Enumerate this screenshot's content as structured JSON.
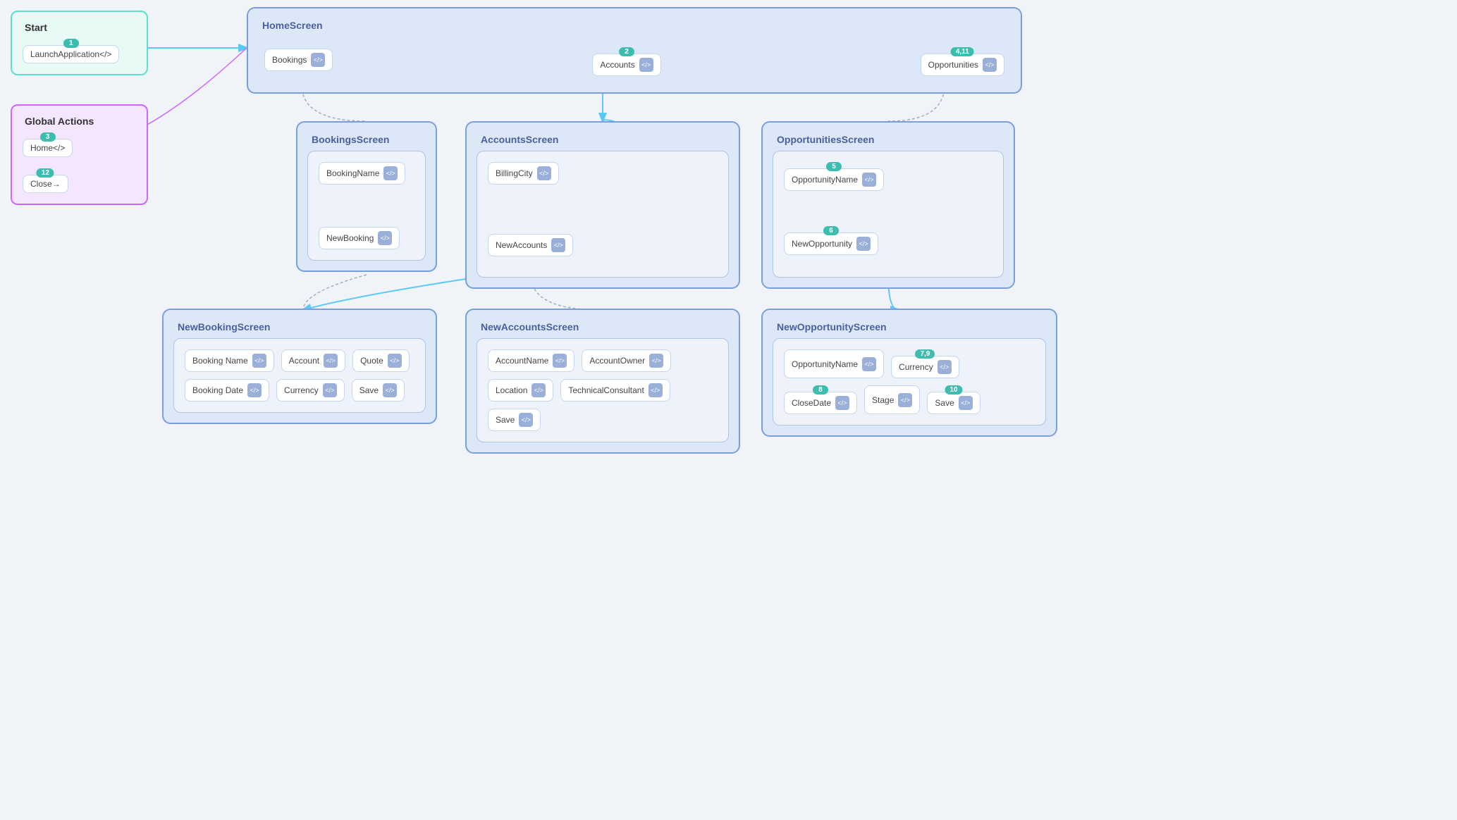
{
  "start": {
    "title": "Start",
    "badge": "1",
    "item": {
      "label": "LaunchApplication",
      "icon": "</>"
    }
  },
  "global": {
    "title": "Global Actions",
    "badge1": "3",
    "item1": {
      "label": "Home",
      "icon": "</>"
    },
    "badge2": "12",
    "item2": {
      "label": "Close",
      "icon": "→"
    }
  },
  "home": {
    "title": "HomeScreen",
    "badge1": "2",
    "badge2": "4,11",
    "item1": {
      "label": "Bookings",
      "icon": "</>"
    },
    "item2": {
      "label": "Accounts",
      "icon": "</>"
    },
    "item3": {
      "label": "Opportunities",
      "icon": "</>"
    }
  },
  "bookingsScreen": {
    "title": "BookingsScreen",
    "items": [
      {
        "label": "BookingName",
        "icon": "</>"
      },
      {
        "label": "NewBooking",
        "icon": "</>"
      }
    ]
  },
  "accountsScreen": {
    "title": "AccountsScreen",
    "items": [
      {
        "label": "BillingCity",
        "icon": "</>"
      },
      {
        "label": "NewAccounts",
        "icon": "</>"
      }
    ]
  },
  "opportunitiesScreen": {
    "title": "OpportunitiesScreen",
    "badge": "5",
    "items": [
      {
        "label": "OpportunityName",
        "icon": "</>"
      },
      {
        "label": "NewOpportunity",
        "icon": "</>"
      }
    ]
  },
  "newBookingScreen": {
    "title": "NewBookingScreen",
    "items": [
      {
        "label": "Booking Name",
        "icon": "</>"
      },
      {
        "label": "Account",
        "icon": "</>"
      },
      {
        "label": "Quote",
        "icon": "</>"
      },
      {
        "label": "Booking Date",
        "icon": "</>"
      },
      {
        "label": "Currency",
        "icon": "</>"
      },
      {
        "label": "Save",
        "icon": "</>"
      }
    ]
  },
  "newAccountsScreen": {
    "title": "NewAccountsScreen",
    "items": [
      {
        "label": "AccountName",
        "icon": "</>"
      },
      {
        "label": "AccountOwner",
        "icon": "</>"
      },
      {
        "label": "Location",
        "icon": "</>"
      },
      {
        "label": "TechnicalConsultant",
        "icon": "</>"
      },
      {
        "label": "Save",
        "icon": "</>"
      }
    ]
  },
  "newOpportunityScreen": {
    "title": "NewOpportunityScreen",
    "badge1": "7,9",
    "badge2": "8",
    "badge3": "10",
    "items": [
      {
        "label": "OpportunityName",
        "icon": "</>"
      },
      {
        "label": "Currency",
        "icon": "</>"
      },
      {
        "label": "CloseDate",
        "icon": "</>"
      },
      {
        "label": "Stage",
        "icon": "</>"
      },
      {
        "label": "Save",
        "icon": "</>"
      }
    ]
  }
}
